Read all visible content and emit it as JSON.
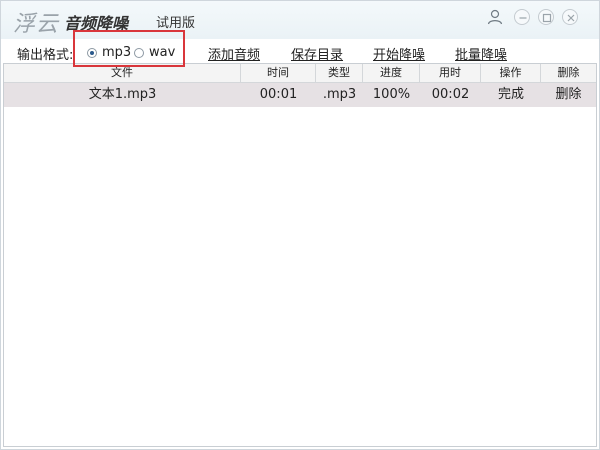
{
  "window": {
    "logo_text": "浮云",
    "app_name": "音频降噪",
    "edition": "试用版"
  },
  "toolbar": {
    "format_label": "输出格式:",
    "format_options": [
      {
        "label": "mp3",
        "selected": true
      },
      {
        "label": "wav",
        "selected": false
      }
    ],
    "add_audio": "添加音频",
    "save_dir": "保存目录",
    "start_denoise": "开始降噪",
    "batch_denoise": "批量降噪",
    "highlight_color": "#d9363b"
  },
  "table": {
    "columns": [
      "文件",
      "时间",
      "类型",
      "进度",
      "用时",
      "操作",
      "删除"
    ],
    "rows": [
      {
        "file": "文本1.mp3",
        "time": "00:01",
        "type": ".mp3",
        "progress": "100%",
        "elapsed": "00:02",
        "action": "完成",
        "delete": "删除"
      }
    ]
  }
}
